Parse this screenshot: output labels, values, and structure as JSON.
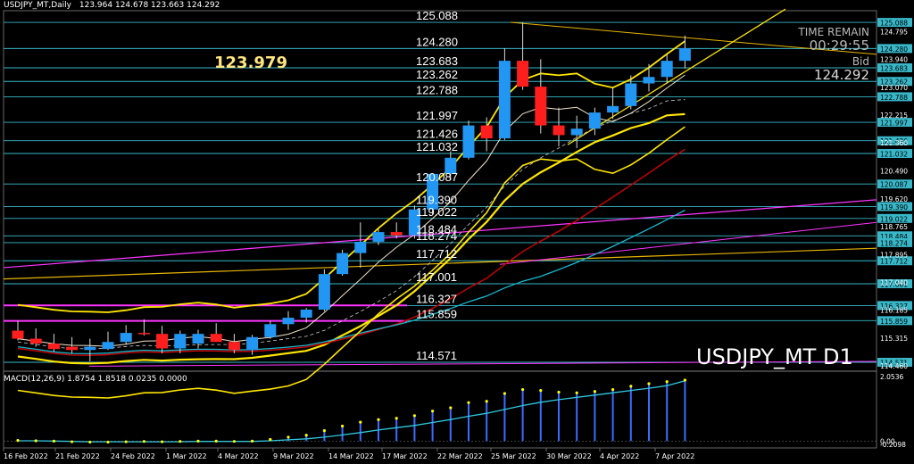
{
  "header": {
    "title": "USDJPY_MT,Daily",
    "ohlc": "123.964 124.678 123.663 124.292"
  },
  "current_price_label": "123.979",
  "info_panel": {
    "time_label": "TIME REMAIN",
    "time_value": "00:29:55",
    "bid_label": "Bid",
    "bid_value": "124.292"
  },
  "watermark": "USDJPY_MT D1",
  "colors": {
    "bull": "#2196f3",
    "bear": "#ff1e1e",
    "level": "#38b7c8",
    "yellow": "#ffe600",
    "magenta": "#ff33ff",
    "macd_hist": "#3a6cff",
    "macd_signal": "#ffff00",
    "macd_line": "#2fc7e0"
  },
  "chart_data": [
    {
      "type": "candlestick",
      "title": "USDJPY_MT,Daily",
      "dates": [
        "16 Feb",
        "17 Feb",
        "18 Feb",
        "21 Feb",
        "22 Feb",
        "23 Feb",
        "24 Feb",
        "25 Feb",
        "28 Feb",
        "1 Mar",
        "2 Mar",
        "3 Mar",
        "4 Mar",
        "7 Mar",
        "8 Mar",
        "9 Mar",
        "10 Mar",
        "11 Mar",
        "14 Mar",
        "15 Mar",
        "16 Mar",
        "17 Mar",
        "18 Mar",
        "21 Mar",
        "22 Mar",
        "23 Mar",
        "24 Mar",
        "25 Mar",
        "28 Mar",
        "29 Mar",
        "30 Mar",
        "31 Mar",
        "1 Apr",
        "4 Apr",
        "5 Apr",
        "6 Apr",
        "7 Apr",
        "8 Apr"
      ],
      "open": [
        115.55,
        115.3,
        115.15,
        115.05,
        114.95,
        114.98,
        115.2,
        115.48,
        115.45,
        115.0,
        115.15,
        115.45,
        115.2,
        114.95,
        115.35,
        115.75,
        115.95,
        116.2,
        117.3,
        117.95,
        118.3,
        118.6,
        118.5,
        119.3,
        120.4,
        120.9,
        121.9,
        121.5,
        123.9,
        123.1,
        121.9,
        121.6,
        121.8,
        122.3,
        122.5,
        123.2,
        123.4,
        123.9
      ],
      "high": [
        115.85,
        115.62,
        115.45,
        115.35,
        115.3,
        115.52,
        115.72,
        115.9,
        115.7,
        115.55,
        115.58,
        115.78,
        115.45,
        115.42,
        115.85,
        116.15,
        116.25,
        117.45,
        118.05,
        118.9,
        118.7,
        118.9,
        119.42,
        120.42,
        121.1,
        122.05,
        122.15,
        124.29,
        125.09,
        123.95,
        122.45,
        122.2,
        122.45,
        123.05,
        123.45,
        123.8,
        124.1,
        124.68
      ],
      "low": [
        115.25,
        115.05,
        114.9,
        114.85,
        114.6,
        114.95,
        115.12,
        115.4,
        114.85,
        114.85,
        115.0,
        115.2,
        114.85,
        114.8,
        115.3,
        115.58,
        115.8,
        116.15,
        117.25,
        117.5,
        118.2,
        118.4,
        118.4,
        119.15,
        120.2,
        120.85,
        121.1,
        121.45,
        123.0,
        121.65,
        121.25,
        121.2,
        121.6,
        122.1,
        122.4,
        122.95,
        123.2,
        123.66
      ],
      "close": [
        115.3,
        115.15,
        114.98,
        114.95,
        115.05,
        115.2,
        115.48,
        115.45,
        115.0,
        115.45,
        115.45,
        115.2,
        114.95,
        115.35,
        115.75,
        115.95,
        116.2,
        117.3,
        117.95,
        118.3,
        118.6,
        118.5,
        119.3,
        120.4,
        120.9,
        121.9,
        121.5,
        123.9,
        123.1,
        121.9,
        121.6,
        121.8,
        122.3,
        122.5,
        123.2,
        123.4,
        123.9,
        124.29
      ],
      "levels": [
        "125.088",
        "124.280",
        "123.683",
        "123.262",
        "122.788",
        "121.997",
        "121.426",
        "121.032",
        "120.087",
        "119.390",
        "119.022",
        "118.484",
        "118.274",
        "117.712",
        "117.001",
        "116.327",
        "115.859",
        "114.571"
      ],
      "y_axis_labels": [
        "125.088",
        "124.795",
        "124.280",
        "123.940",
        "123.683",
        "123.262",
        "123.070",
        "122.788",
        "122.215",
        "121.997",
        "121.426",
        "121.360",
        "121.032",
        "120.490",
        "120.087",
        "119.620",
        "119.390",
        "119.022",
        "118.765",
        "118.484",
        "118.274",
        "117.895",
        "117.712",
        "117.040",
        "117.001",
        "116.327",
        "116.185",
        "115.859",
        "115.315",
        "114.571",
        "114.460"
      ],
      "x_axis_labels": [
        "16 Feb 2022",
        "21 Feb 2022",
        "24 Feb 2022",
        "1 Mar 2022",
        "4 Mar 2022",
        "9 Mar 2022",
        "14 Mar 2022",
        "17 Mar 2022",
        "22 Mar 2022",
        "25 Mar 2022",
        "30 Mar 2022",
        "4 Apr 2022",
        "7 Apr 2022"
      ],
      "ylim": [
        114.35,
        125.45
      ]
    },
    {
      "type": "bar",
      "title": "MACD(12,26,9) 1.8754 1.8518 0.0235 0.0000",
      "histogram": [
        0.02,
        0.01,
        0.0,
        -0.02,
        -0.03,
        -0.03,
        -0.02,
        -0.01,
        -0.02,
        -0.01,
        0.0,
        0.0,
        -0.01,
        0.0,
        0.05,
        0.12,
        0.18,
        0.32,
        0.46,
        0.58,
        0.66,
        0.7,
        0.78,
        0.92,
        1.02,
        1.18,
        1.22,
        1.46,
        1.58,
        1.55,
        1.5,
        1.48,
        1.52,
        1.58,
        1.68,
        1.76,
        1.82,
        1.87
      ],
      "signal": [
        0.01,
        0.01,
        0.0,
        -0.01,
        -0.02,
        -0.02,
        -0.02,
        -0.02,
        -0.02,
        -0.02,
        -0.01,
        -0.01,
        -0.01,
        -0.01,
        0.01,
        0.04,
        0.07,
        0.12,
        0.19,
        0.26,
        0.34,
        0.41,
        0.48,
        0.57,
        0.66,
        0.76,
        0.85,
        0.97,
        1.09,
        1.19,
        1.27,
        1.34,
        1.41,
        1.48,
        1.55,
        1.62,
        1.7,
        1.85
      ],
      "y_axis_labels": [
        "2.0536",
        "0.00",
        "-0.2098"
      ],
      "ylim": [
        -0.21,
        2.06
      ]
    }
  ]
}
